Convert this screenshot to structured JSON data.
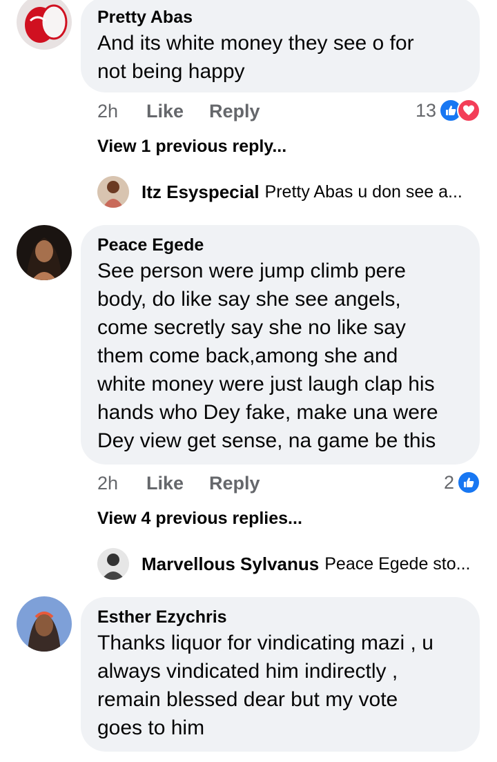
{
  "comments": [
    {
      "author": "Pretty Abas",
      "text_lines": [
        "And its white money they see o for",
        "not being happy"
      ],
      "time": "2h",
      "like_label": "Like",
      "reply_label": "Reply",
      "reaction_count": "13",
      "reactions": [
        "like-icon",
        "love-icon"
      ],
      "view_replies": "View 1 previous reply...",
      "latest_reply": {
        "author": "Itz Esyspecial",
        "preview": "Pretty Abas u don see a..."
      }
    },
    {
      "author": "Peace Egede",
      "text_lines": [
        "See person were jump climb pere",
        "body, do like say she see angels,",
        "come secretly say she no like say",
        "them come back,among she and",
        "white money were just laugh clap his",
        "hands who Dey fake, make una were",
        "Dey view get sense, na game be this"
      ],
      "time": "2h",
      "like_label": "Like",
      "reply_label": "Reply",
      "reaction_count": "2",
      "reactions": [
        "like-icon"
      ],
      "view_replies": "View 4 previous replies...",
      "latest_reply": {
        "author": "Marvellous Sylvanus",
        "preview": "Peace Egede  sto..."
      }
    },
    {
      "author": "Esther Ezychris",
      "text_lines": [
        "Thanks liquor  for vindicating mazi , u",
        "always vindicated him indirectly ,",
        "remain blessed dear but my vote",
        "goes to him"
      ]
    }
  ],
  "colors": {
    "bubble": "#f0f2f5",
    "meta": "#65676b",
    "like": "#1877f2",
    "love": "#f33e58"
  }
}
